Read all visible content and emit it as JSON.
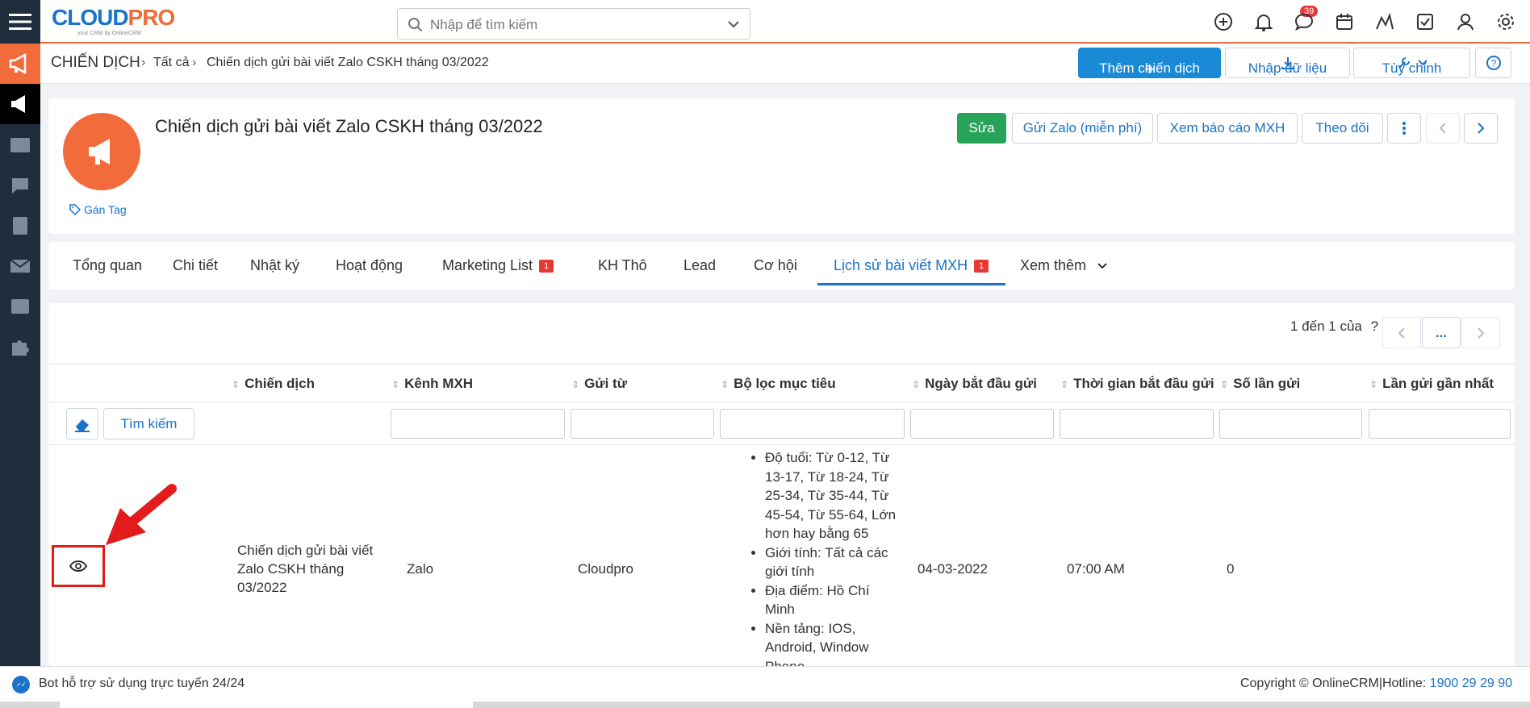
{
  "app": {
    "logo_main": "CLOUD",
    "logo_accent": "PRO",
    "logo_tag": "your CRM by OnlineCRM"
  },
  "search": {
    "placeholder": "Nhập để tìm kiếm"
  },
  "notifications": {
    "count": "39"
  },
  "breadcrumb": {
    "module": "CHIẾN DỊCH",
    "all": "Tất cả",
    "current": "Chiến dịch gửi bài viết Zalo CSKH tháng 03/2022"
  },
  "toolbar": {
    "add": "Thêm chiến dịch",
    "import": "Nhập dữ liệu",
    "customize": "Tùy chỉnh"
  },
  "record": {
    "title": "Chiến dịch gửi bài viết Zalo CSKH tháng 03/2022",
    "tag_label": "Gán Tag",
    "edit": "Sửa",
    "send_zalo": "Gửi Zalo (miễn phí)",
    "report": "Xem báo cáo MXH",
    "follow": "Theo dõi"
  },
  "tabs": [
    {
      "label": "Tổng quan"
    },
    {
      "label": "Chi tiết"
    },
    {
      "label": "Nhật ký"
    },
    {
      "label": "Hoạt động"
    },
    {
      "label": "Marketing List",
      "badge": "1"
    },
    {
      "label": "KH Thô"
    },
    {
      "label": "Lead"
    },
    {
      "label": "Cơ hội"
    },
    {
      "label": "Lịch sử bài viết MXH",
      "badge": "1"
    },
    {
      "label": "Xem thêm"
    }
  ],
  "pagination": {
    "text": "1 đến 1 của",
    "help": "?",
    "more": "..."
  },
  "table": {
    "columns": [
      "Chiến dịch",
      "Kênh MXH",
      "Gửi từ",
      "Bộ lọc mục tiêu",
      "Ngày bắt đầu gửi",
      "Thời gian bắt đầu gửi",
      "Số lần gửi",
      "Lần gửi gần nhất"
    ],
    "search_button": "Tìm kiếm",
    "row": {
      "campaign": "Chiến dịch gửi bài viết Zalo CSKH tháng 03/2022",
      "channel": "Zalo",
      "sender": "Cloudpro",
      "filters": [
        "Độ tuổi: Từ 0-12, Từ 13-17, Từ 18-24, Từ 25-34, Từ 35-44, Từ 45-54, Từ 55-64, Lớn hơn hay bằng 65",
        "Giới tính: Tất cả các giới tính",
        "Địa điểm: Hồ Chí Minh",
        "Nền tảng: IOS, Android, Window Phone"
      ],
      "start_date": "04-03-2022",
      "start_time": "07:00 AM",
      "send_count": "0"
    }
  },
  "footer": {
    "bot": "Bot hỗ trợ sử dụng trực tuyến 24/24",
    "copyright": "Copyright © OnlineCRM",
    "sep": "|Hotline: ",
    "hotline": "1900 29 29 90"
  },
  "colors": {
    "brand": "#1a73c8",
    "accent": "#f26b3a",
    "success": "#27a35a",
    "annotation": "#e31b1b"
  }
}
